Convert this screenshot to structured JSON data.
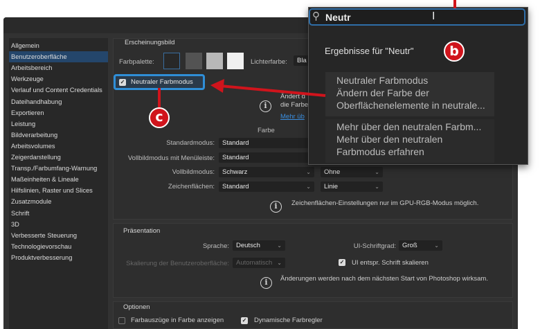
{
  "sidebar": {
    "items": [
      "Allgemein",
      "Benutzeroberfläche",
      "Arbeitsbereich",
      "Werkzeuge",
      "Verlauf und Content Credentials",
      "Dateihandhabung",
      "Exportieren",
      "Leistung",
      "Bildverarbeitung",
      "Arbeitsvolumes",
      "Zeigerdarstellung",
      "Transp./Farbumfang-Warnung",
      "Maßeinheiten & Lineale",
      "Hilfslinien, Raster und Slices",
      "Zusatzmodule",
      "Schrift",
      "3D",
      "Verbesserte Steuerung",
      "Technologievorschau",
      "Produktverbesserung"
    ],
    "selected": "Benutzeroberfläche"
  },
  "appearance": {
    "title": "Erscheinungsbild",
    "palette_label": "Farbpalette:",
    "palette_colors": [
      "#282828",
      "#535353",
      "#b8b8b8",
      "#f0f0f0"
    ],
    "highlight_label": "Lichterfarbe:",
    "highlight_value": "Bla",
    "neutral_mode_label": "Neutraler Farbmodus",
    "neutral_mode_checked": true,
    "info_line1": "Ändert d",
    "info_line2": "die Farbe",
    "info_link": "Mehr üb",
    "color_header": "Farbe",
    "rows": [
      {
        "label": "Standardmodus:",
        "color": "Standard"
      },
      {
        "label": "Vollbildmodus mit Menüleiste:",
        "color": "Standard"
      },
      {
        "label": "Vollbildmodus:",
        "color": "Schwarz",
        "border": "Ohne"
      },
      {
        "label": "Zeichenflächen:",
        "color": "Standard",
        "border": "Linie"
      }
    ],
    "artboard_info": "Zeichenflächen-Einstellungen nur im GPU-RGB-Modus möglich."
  },
  "presentation": {
    "title": "Präsentation",
    "language_label": "Sprache:",
    "language_value": "Deutsch",
    "ui_font_label": "UI-Schriftgrad:",
    "ui_font_value": "Groß",
    "scaling_label": "Skalierung der Benutzeroberfläche:",
    "scaling_value": "Automatisch",
    "scale_ui_label": "UI entspr. Schrift skalieren",
    "scale_ui_checked": true,
    "restart_info": "Änderungen werden nach dem nächsten Start von Photoshop wirksam."
  },
  "options": {
    "title": "Optionen",
    "color_channels_label": "Farbauszüge in Farbe anzeigen",
    "color_channels_checked": false,
    "dynamic_sliders_label": "Dynamische Farbregler",
    "dynamic_sliders_checked": true
  },
  "search": {
    "value": "Neutr",
    "results_heading": "Ergebnisse für \"Neutr\"",
    "results": [
      {
        "title": "Neutraler Farbmodus",
        "desc1": "Ändern der Farbe der",
        "desc2": "Oberflächenelemente in neutrale..."
      },
      {
        "title": "Mehr über den neutralen Farbm...",
        "desc1": "Mehr über den neutralen",
        "desc2": "Farbmodus erfahren"
      }
    ]
  },
  "annotations": {
    "b": "b",
    "c": "c",
    "color": "#d0141c"
  }
}
